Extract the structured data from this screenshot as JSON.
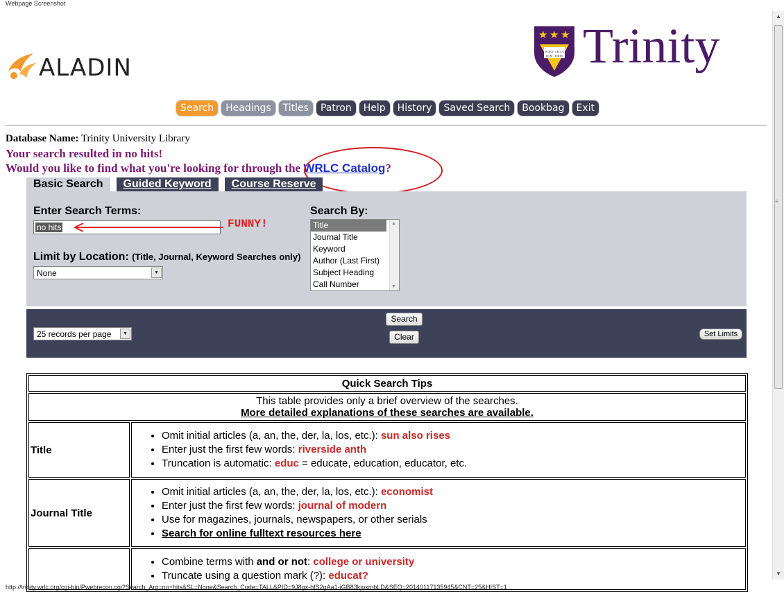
{
  "watermark": "Webpage Screenshot",
  "logos": {
    "aladin": "ALADIN",
    "trinity": "Trinity",
    "shield_text": "SCIENTIA CELLA FIDES"
  },
  "nav": [
    {
      "label": "Search",
      "state": "active"
    },
    {
      "label": "Headings",
      "state": "light"
    },
    {
      "label": "Titles",
      "state": "light"
    },
    {
      "label": "Patron",
      "state": "dark"
    },
    {
      "label": "Help",
      "state": "dark"
    },
    {
      "label": "History",
      "state": "dark"
    },
    {
      "label": "Saved Search",
      "state": "dark"
    },
    {
      "label": "Bookbag",
      "state": "dark"
    },
    {
      "label": "Exit",
      "state": "dark"
    }
  ],
  "database": {
    "label": "Database Name:",
    "value": "Trinity University Library"
  },
  "messages": {
    "no_hits": "Your search resulted in no hits!",
    "suggest_prefix": "Would you like to find what you're looking for through the ",
    "suggest_link": "WRLC Catalog",
    "suggest_suffix": "?"
  },
  "tabs": [
    "Basic Search",
    "Guided Keyword",
    "Course Reserve"
  ],
  "search": {
    "terms_label": "Enter Search Terms:",
    "terms_value": "no hits",
    "annotation": "FUNNY!",
    "location_label": "Limit by Location:",
    "location_note": "(Title, Journal, Keyword Searches only)",
    "location_value": "None",
    "searchby_label": "Search By:",
    "searchby_options": [
      "Title",
      "Journal Title",
      "Keyword",
      "Author (Last First)",
      "Subject Heading",
      "Call Number"
    ],
    "searchby_selected": "Title"
  },
  "actions": {
    "records_per_page": "25 records per page",
    "search": "Search",
    "clear": "Clear",
    "set_limits": "Set Limits"
  },
  "tips": {
    "title": "Quick Search Tips",
    "intro": "This table provides only a brief overview of the searches.",
    "intro_link": "More detailed explanations of these searches are available.",
    "title_row": {
      "label": "Title",
      "b1_text": "Omit initial articles (a, an, the, der, la, los, etc.): ",
      "b1_ex": "sun also rises",
      "b2_text": "Enter just the first few words: ",
      "b2_ex": "riverside anth",
      "b3_text": "Truncation is automatic: ",
      "b3_ex": "educ",
      "b3_tail": " = educate, education, educator, etc."
    },
    "journal_row": {
      "label": "Journal Title",
      "b1_text": "Omit initial articles (a, an, the, der, la, los, etc.): ",
      "b1_ex": "economist",
      "b2_text": "Enter just the first few words: ",
      "b2_ex": "journal of modern",
      "b3_text": "Use for magazines, journals, newspapers, or other serials",
      "b4_link": "Search for online fulltext resources here"
    },
    "keyword_row": {
      "b1_text": "Combine terms with ",
      "b1_bold": "and or not",
      "b1_colon": ": ",
      "b1_ex": "college or university",
      "b2_text": "Truncate using a question mark (?): ",
      "b2_ex": "educat?"
    }
  },
  "status_url": "http://trinity.wrlc.org/cgi-bin/Pwebrecon.cgi?Search_Arg=no+hits&SL=None&Search_Code=TALL&PID=9J8gx-hfS2gAa1-iGB83kjoxmbLD&SEQ=20140117135945&CNT=25&HIST=1"
}
